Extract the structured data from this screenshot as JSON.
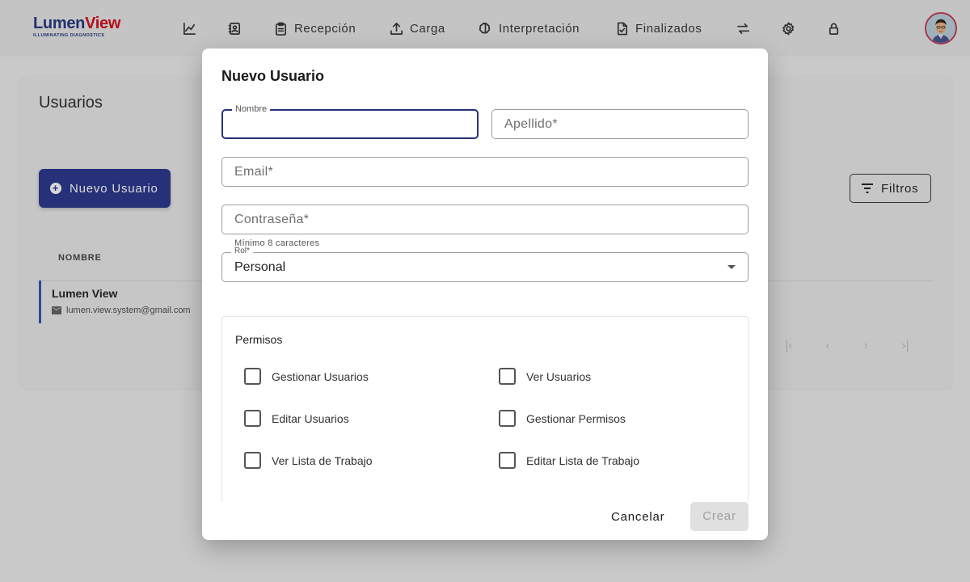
{
  "brand": {
    "name_part1": "Lumen",
    "name_part2": "View",
    "tagline": "ILLUMINATING DIAGNOSTICS"
  },
  "nav": {
    "items": [
      {
        "label": "",
        "icon": "chart-icon"
      },
      {
        "label": "",
        "icon": "contacts-icon"
      },
      {
        "label": "Recepción",
        "icon": "clipboard-icon"
      },
      {
        "label": "Carga",
        "icon": "upload-icon"
      },
      {
        "label": "Interpretación",
        "icon": "brain-icon"
      },
      {
        "label": "Finalizados",
        "icon": "file-check-icon"
      },
      {
        "label": "",
        "icon": "swap-icon"
      },
      {
        "label": "",
        "icon": "gear-icon"
      },
      {
        "label": "",
        "icon": "lock-icon"
      }
    ]
  },
  "page": {
    "title": "Usuarios",
    "new_user_button": "Nuevo Usuario",
    "filters_button": "Filtros",
    "table": {
      "columns": [
        "NOMBRE"
      ],
      "rows": [
        {
          "name": "Lumen View",
          "email": "lumen.view.system@gmail.com"
        }
      ]
    }
  },
  "modal": {
    "title": "Nuevo Usuario",
    "fields": {
      "nombre": {
        "label": "Nombre",
        "value": ""
      },
      "apellido": {
        "placeholder": "Apellido*"
      },
      "email": {
        "placeholder": "Email*"
      },
      "password": {
        "placeholder": "Contraseña*",
        "helper": "Mínimo 8 caracteres"
      },
      "rol": {
        "label": "Rol*",
        "value": "Personal"
      }
    },
    "permissions": {
      "title": "Permisos",
      "items": [
        {
          "label": "Gestionar Usuarios",
          "checked": false
        },
        {
          "label": "Ver Usuarios",
          "checked": false
        },
        {
          "label": "Editar Usuarios",
          "checked": false
        },
        {
          "label": "Gestionar Permisos",
          "checked": false
        },
        {
          "label": "Ver Lista de Trabajo",
          "checked": false
        },
        {
          "label": "Editar Lista de Trabajo",
          "checked": false
        }
      ]
    },
    "actions": {
      "cancel": "Cancelar",
      "create": "Crear"
    }
  },
  "colors": {
    "primary": "#26317a",
    "brand_red": "#b3101a",
    "overlay": "#c9c9c9"
  }
}
